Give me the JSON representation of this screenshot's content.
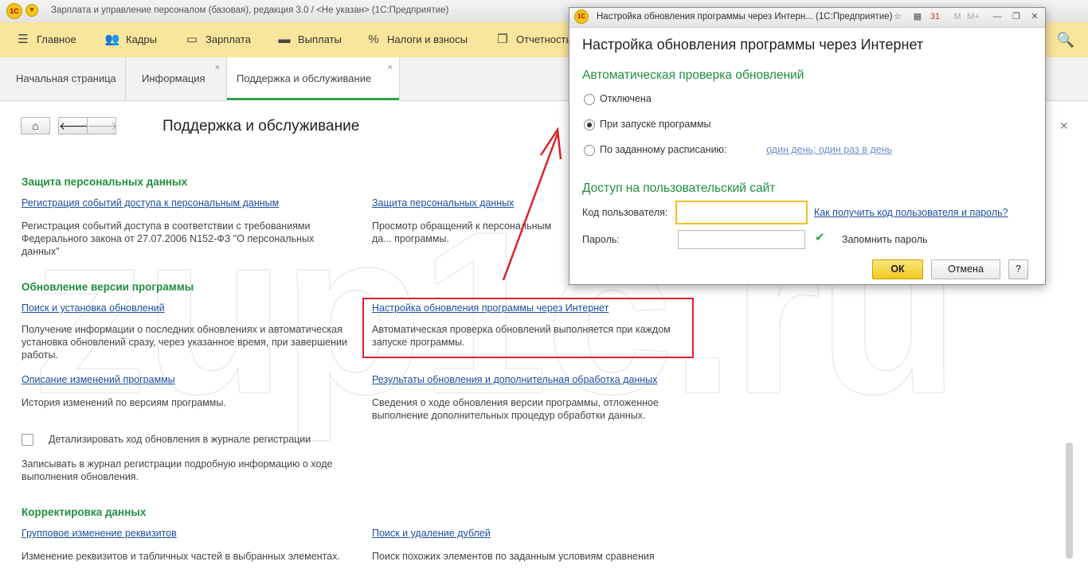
{
  "window": {
    "title": "Зарплата и управление персоналом (базовая), редакция 3.0 / <Не указан>  (1С:Предприятие)",
    "logo_text": "1С"
  },
  "menu": {
    "items": [
      {
        "label": "Главное",
        "icon": "hamburger-icon"
      },
      {
        "label": "Кадры",
        "icon": "people-icon"
      },
      {
        "label": "Зарплата",
        "icon": "wallet-icon"
      },
      {
        "label": "Выплаты",
        "icon": "cash-icon"
      },
      {
        "label": "Налоги и взносы",
        "icon": "percent-icon"
      },
      {
        "label": "Отчетность",
        "icon": "reports-icon"
      }
    ]
  },
  "tabs": [
    {
      "label": "Начальная страница",
      "closable": false
    },
    {
      "label": "Информация",
      "closable": true
    },
    {
      "label": "Поддержка и обслуживание",
      "closable": true,
      "active": true
    }
  ],
  "page": {
    "title": "Поддержка и обслуживание"
  },
  "sections": {
    "personal": {
      "heading": "Защита персональных данных",
      "left_link": "Регистрация событий доступа к персональным данным",
      "left_desc": "Регистрация событий доступа в соответствии с требованиями Федерального закона от 27.07.2006 N152-ФЗ \"О персональных данных\"",
      "right_link": "Защита персональных данных",
      "right_desc": "Просмотр обращений к персональным да... программы."
    },
    "update": {
      "heading": "Обновление версии программы",
      "left_link": "Поиск и установка обновлений",
      "left_desc": "Получение информации о последних обновлениях и автоматическая установка обновлений сразу, через указанное время, при завершении работы.",
      "right_link": "Настройка обновления программы через Интернет",
      "right_desc": "Автоматическая проверка обновлений выполняется при каждом запуске программы.",
      "left_link2": "Описание изменений программы",
      "left_desc2": "История изменений по версиям программы.",
      "right_link2": "Результаты обновления и дополнительная обработка данных",
      "right_desc2": "Сведения о ходе обновления версии программы, отложенное выполнение дополнительных процедур обработки данных.",
      "checkbox_label": "Детализировать ход обновления в журнале регистрации",
      "checkbox_desc": "Записывать в журнал регистрации подробную информацию о ходе выполнения обновления."
    },
    "correction": {
      "heading": "Корректировка данных",
      "left_link": "Групповое изменение реквизитов",
      "left_desc": "Изменение реквизитов и табличных частей в выбранных элементах.",
      "right_link": "Поиск и удаление дублей",
      "right_desc": "Поиск похожих элементов по заданным условиям сравнения"
    }
  },
  "watermark": "zup1c.ru",
  "dialog": {
    "window_title": "Настройка обновления программы через Интерн...  (1С:Предприятие)",
    "heading": "Настройка обновления программы через Интернет",
    "auto_check": {
      "heading": "Автоматическая проверка обновлений",
      "options": [
        {
          "label": "Отключена",
          "selected": false
        },
        {
          "label": "При запуске программы",
          "selected": true
        },
        {
          "label": "По заданному расписанию:",
          "selected": false
        }
      ],
      "schedule_link": "один день; один раз в день"
    },
    "access": {
      "heading": "Доступ на пользовательский сайт",
      "user_code_label": "Код пользователя:",
      "user_code_value": "",
      "help_link": "Как получить код пользователя и пароль?",
      "password_label": "Пароль:",
      "password_value": "",
      "remember_label": "Запомнить пароль",
      "remember_checked": true
    },
    "buttons": {
      "ok": "ОК",
      "cancel": "Отмена",
      "help": "?"
    },
    "window_buttons": {
      "minimize_letter": "M",
      "maximize_letter": "M+",
      "minimize": "—",
      "restore": "❐",
      "close": "✕"
    }
  },
  "colors": {
    "menu_bg": "#f9e59b",
    "section_green": "#1f8f3e",
    "link_blue": "#1d4fa1",
    "highlight_red": "#d9232a",
    "ok_yellow": "#f0c91e"
  }
}
